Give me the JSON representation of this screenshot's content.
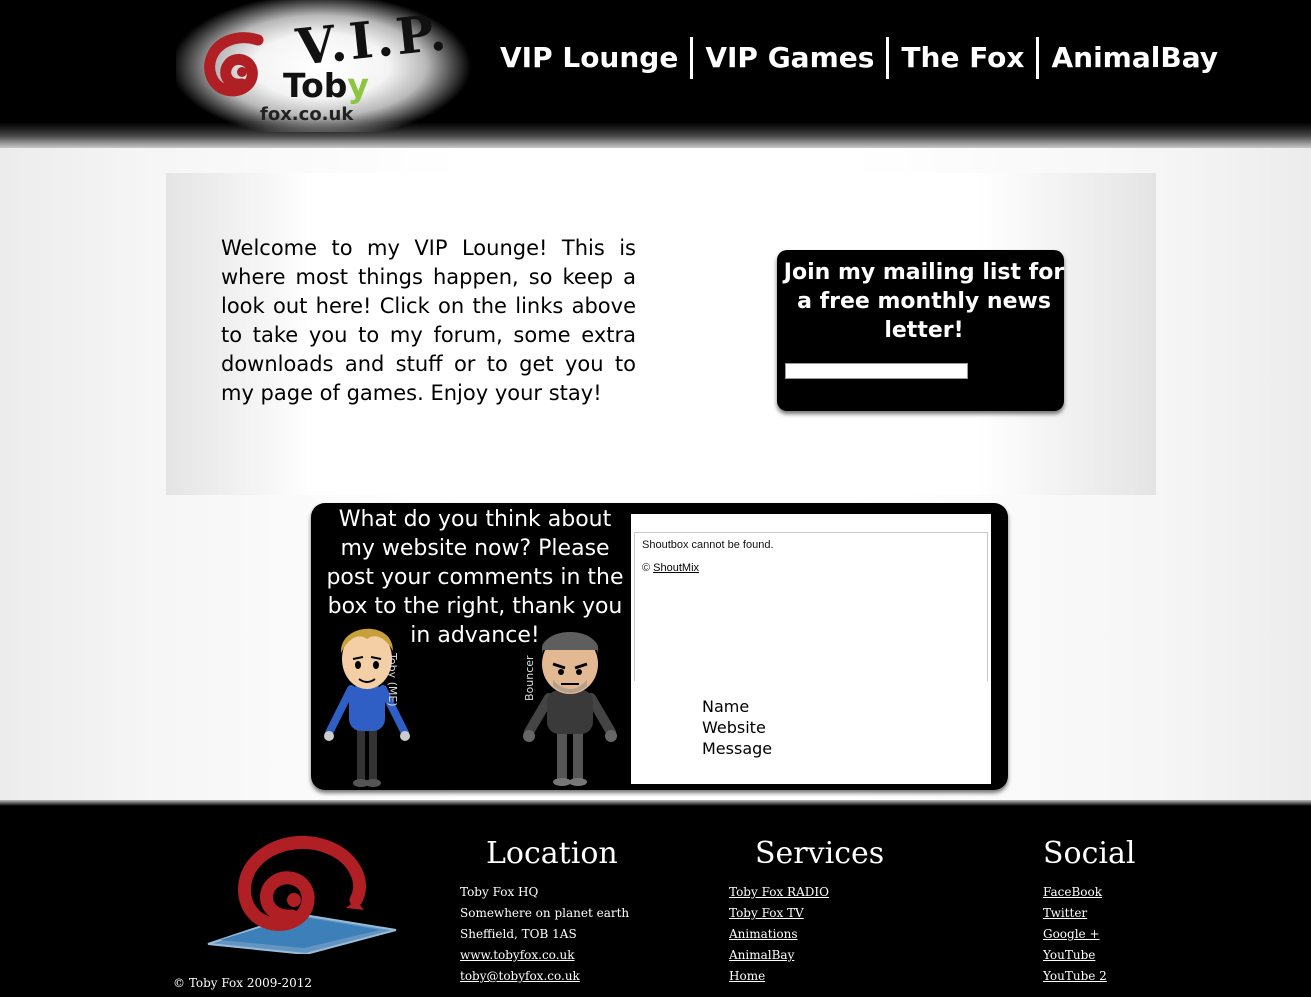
{
  "header": {
    "logo": {
      "vip_text": "V.I.P.",
      "brand_toby_start": "Tob",
      "brand_toby_end": "y",
      "domain": "fox.co.uk"
    },
    "nav": [
      {
        "label": "VIP Lounge"
      },
      {
        "label": "VIP Games"
      },
      {
        "label": "The Fox"
      },
      {
        "label": "AnimalBay"
      }
    ]
  },
  "main": {
    "welcome_text": "Welcome to my VIP Lounge! This is where most things happen, so keep a look out here! Click on the links above to take you to my forum, some extra downloads and stuff or to get you to my page of games. Enjoy your stay!",
    "mailing": {
      "text": "Join my mailing list for a free monthly news letter!",
      "input_value": ""
    }
  },
  "comments": {
    "prompt": "What do you think about my website now? Please post your comments in the box to the right, thank you in advance!",
    "mii_left_label": "Toby (ME)",
    "mii_right_label": "Bouncer",
    "shoutbox": {
      "message": "Shoutbox cannot be found.",
      "copyright_symbol": "©",
      "link": "ShoutMix",
      "form_labels": [
        "Name",
        "Website",
        "Message"
      ]
    }
  },
  "footer": {
    "copyright": "© Toby Fox 2009-2012",
    "location": {
      "title": "Location",
      "lines": [
        "Toby Fox HQ",
        "Somewhere on planet earth",
        "Sheffield, TOB 1AS"
      ],
      "links": [
        "www.tobyfox.co.uk",
        "toby@tobyfox.co.uk"
      ]
    },
    "services": {
      "title": "Services",
      "links": [
        "Toby Fox RADIO",
        "Toby Fox TV",
        "Animations",
        "AnimalBay",
        "Home"
      ]
    },
    "social": {
      "title": "Social",
      "links": [
        "FaceBook",
        "Twitter",
        "Google +",
        "YouTube",
        "YouTube 2"
      ]
    }
  },
  "colors": {
    "background": "#ffffff",
    "header_bg": "#000000",
    "logo_red": "#b01f24",
    "logo_green": "#8cc63f",
    "panel_black": "#000000"
  }
}
